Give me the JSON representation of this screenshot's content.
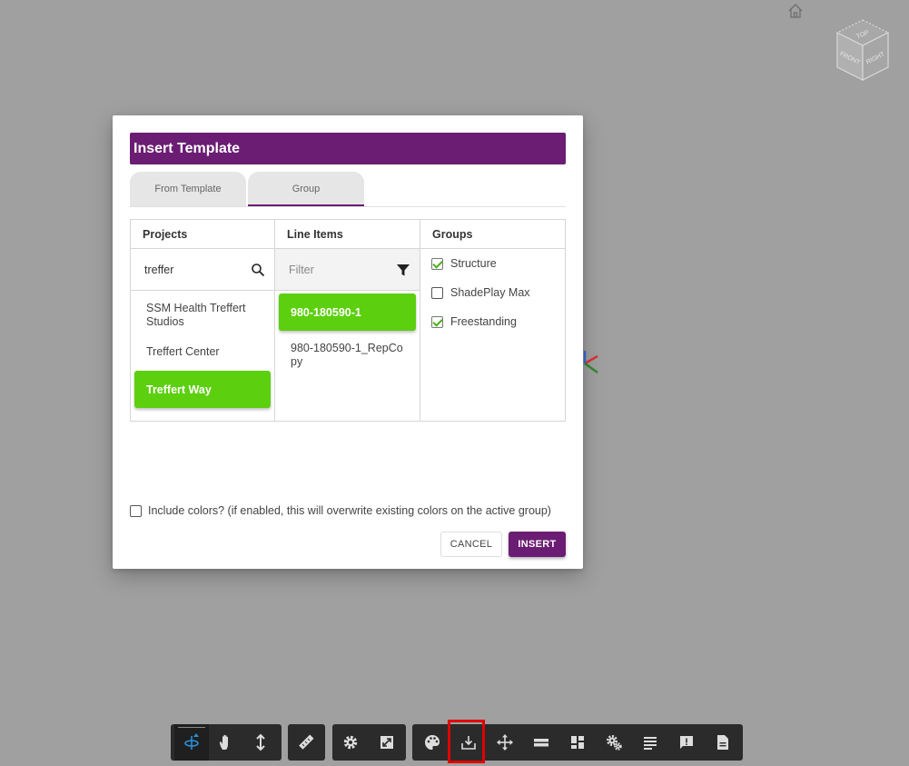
{
  "viewport": {
    "home_icon": "home-icon",
    "view_cube": {
      "top": "TOP",
      "front": "FRONT",
      "right": "RIGHT"
    }
  },
  "dialog": {
    "title": "Insert Template",
    "tabs": [
      {
        "label": "From Template"
      },
      {
        "label": "Group",
        "active": true
      }
    ],
    "columns": {
      "projects": {
        "header": "Projects",
        "search_value": "treffer",
        "items": [
          {
            "label": "SSM Health Treffert Studios"
          },
          {
            "label": "Treffert Center"
          },
          {
            "label": "Treffert Way",
            "selected": true
          }
        ]
      },
      "line_items": {
        "header": "Line Items",
        "filter_placeholder": "Filter",
        "items": [
          {
            "label": "980-180590-1",
            "selected": true
          },
          {
            "label": "980-180590-1_RepCopy"
          }
        ]
      },
      "groups": {
        "header": "Groups",
        "items": [
          {
            "label": "Structure",
            "checked": true
          },
          {
            "label": "ShadePlay Max",
            "checked": false
          },
          {
            "label": "Freestanding",
            "checked": true
          }
        ]
      }
    },
    "include_colors": {
      "label": "Include colors? (if enabled, this will overwrite existing colors on the active group)",
      "checked": false
    },
    "buttons": {
      "cancel": "CANCEL",
      "insert": "INSERT"
    }
  },
  "toolbar": {
    "groups": [
      [
        "orbit-icon",
        "pan-hand-icon",
        "vertical-move-icon"
      ],
      [
        "ruler-icon"
      ],
      [
        "settings-gear-icon",
        "resize-icon"
      ],
      [
        "palette-icon",
        "download-tray-icon",
        "move-arrows-icon",
        "layers-icon",
        "dashboard-icon",
        "gears-icon",
        "text-lines-icon",
        "feedback-icon",
        "document-icon"
      ]
    ],
    "active_tool": "orbit-icon",
    "highlighted_tool": "download-tray-icon",
    "colors": {
      "accent": "#6b1d73",
      "selection": "#5ccf0e",
      "highlight": "#e00000",
      "toolbar": "#2b2b2b"
    }
  }
}
